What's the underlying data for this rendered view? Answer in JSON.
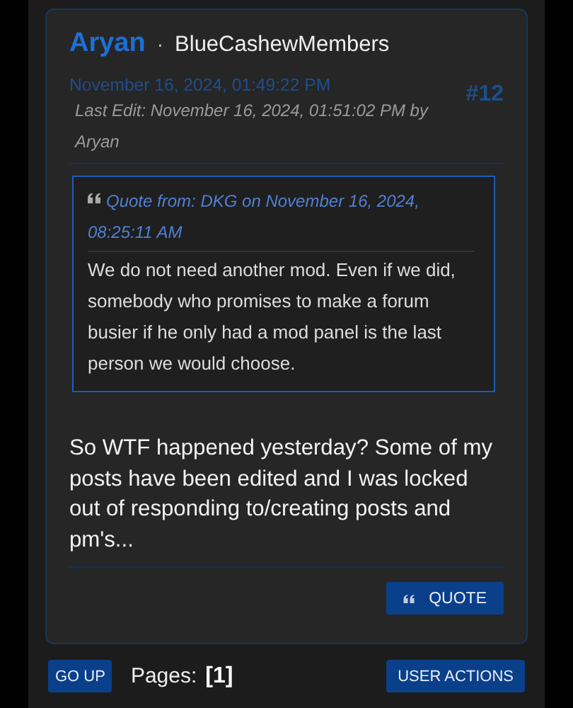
{
  "post": {
    "author": "Aryan",
    "separator": "·",
    "group": "BlueCashewMembers",
    "date": "November 16, 2024, 01:49:22 PM",
    "number": "#12",
    "last_edit": "Last Edit: November 16, 2024, 01:51:02 PM by Aryan",
    "quote": {
      "header": "Quote from: DKG on November 16, 2024, 08:25:11 AM",
      "text": "We do not need another mod. Even if we did, somebody who promises to make a forum busier if he only had a mod panel is the last person we would choose."
    },
    "body": "So WTF happened yesterday? Some of my posts have been edited and I was locked out of responding to/creating posts and pm's...",
    "buttons": [
      "QUOTE"
    ]
  },
  "footer": {
    "go_up": "GO UP",
    "pages_label": "Pages:",
    "current_page": "[1]",
    "user_actions": "USER ACTIONS"
  }
}
